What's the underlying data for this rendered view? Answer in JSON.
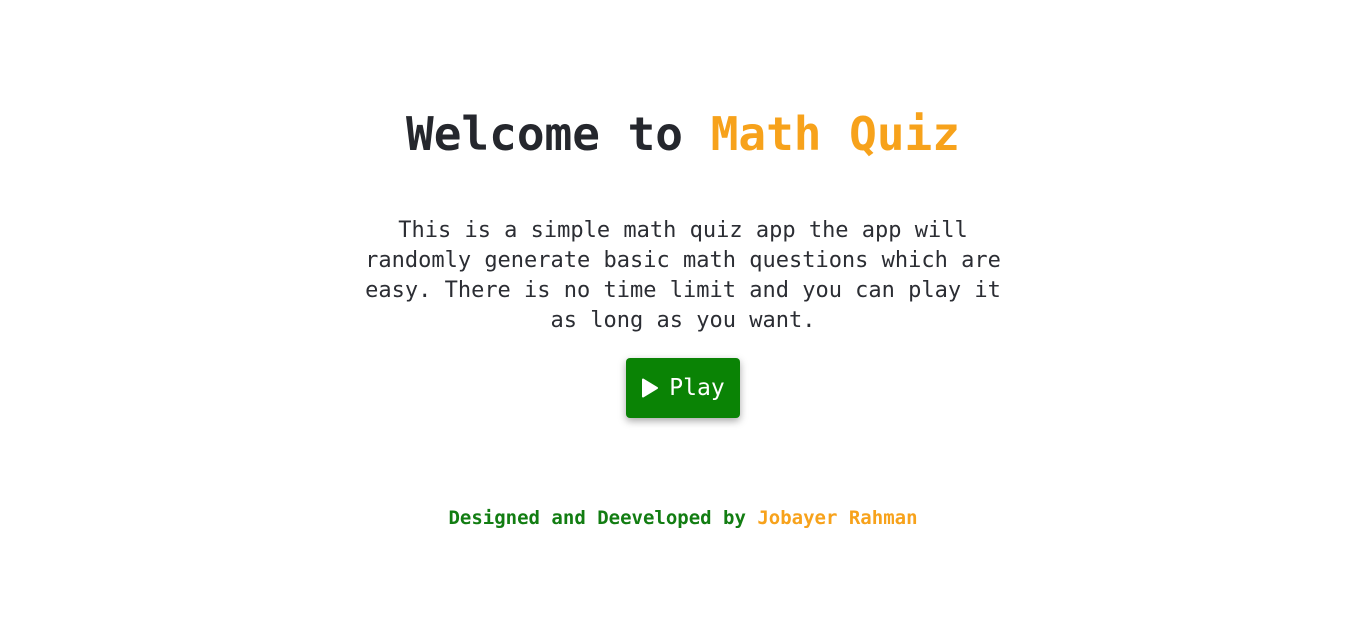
{
  "header": {
    "title_prefix": "Welcome to ",
    "title_highlight": "Math Quiz"
  },
  "main": {
    "description": "This is a simple math quiz app the app will randomly generate basic math questions which are easy. There is no time limit and you can play it as long as you want.",
    "play_button": {
      "label": "Play",
      "icon": "play-icon"
    }
  },
  "footer": {
    "credit_label": "Designed and Deeveloped by",
    "author": "Jobayer Rahman"
  },
  "colors": {
    "accent": "#f7a21b",
    "play_bg": "#0a8305",
    "credit": "#127d12",
    "text": "#25272d"
  }
}
